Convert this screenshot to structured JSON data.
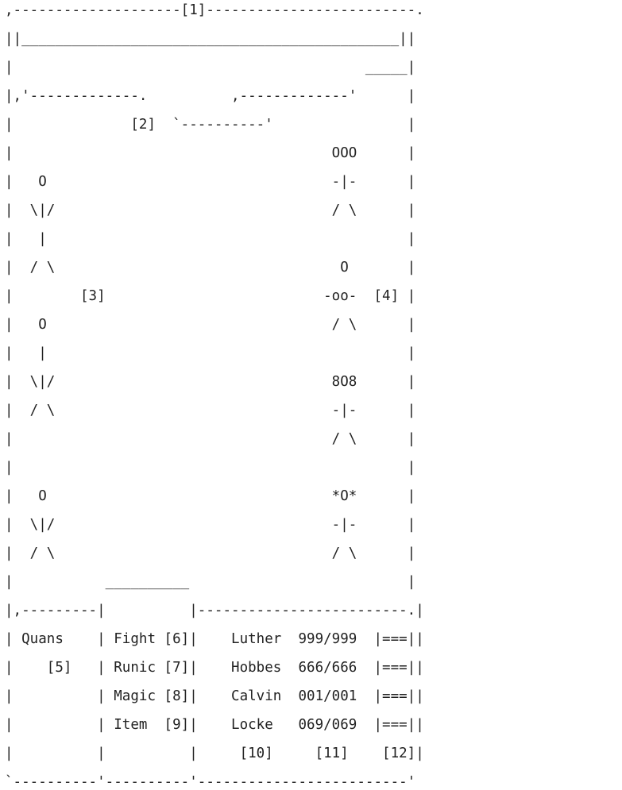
{
  "battle_screen": {
    "lines": [
      ",--------------------[1]-------------------------.",
      "||_____________________________________________||",
      "|                                          _____|",
      "|,'-------------.          ,-------------'      |",
      "|              [2]  `----------'                |",
      "|                                      OOO      |",
      "|   O                                  -|-      |",
      "|  \\|/                                 / \\      |",
      "|   |                                           |",
      "|  / \\                                  O       |",
      "|        [3]                          -oo-  [4] |",
      "|   O                                  / \\      |",
      "|   |                                           |",
      "|  \\|/                                 8O8      |",
      "|  / \\                                 -|-      |",
      "|                                      / \\      |",
      "|                                               |",
      "|   O                                  *O*      |",
      "|  \\|/                                 -|-      |",
      "|  / \\                                 / \\      |",
      "|           __________                          |",
      "|,---------|          |-------------------------.|",
      "| Quans    | Fight [6]|    Luther  999/999  |===||",
      "|    [5]   | Runic [7]|    Hobbes  666/666  |===||",
      "|          | Magic [8]|    Calvin  001/001  |===||",
      "|          | Item  [9]|    Locke   069/069  |===||",
      "|          |          |     [10]     [11]    [12]|",
      "`----------'----------'-------------------------'"
    ]
  }
}
